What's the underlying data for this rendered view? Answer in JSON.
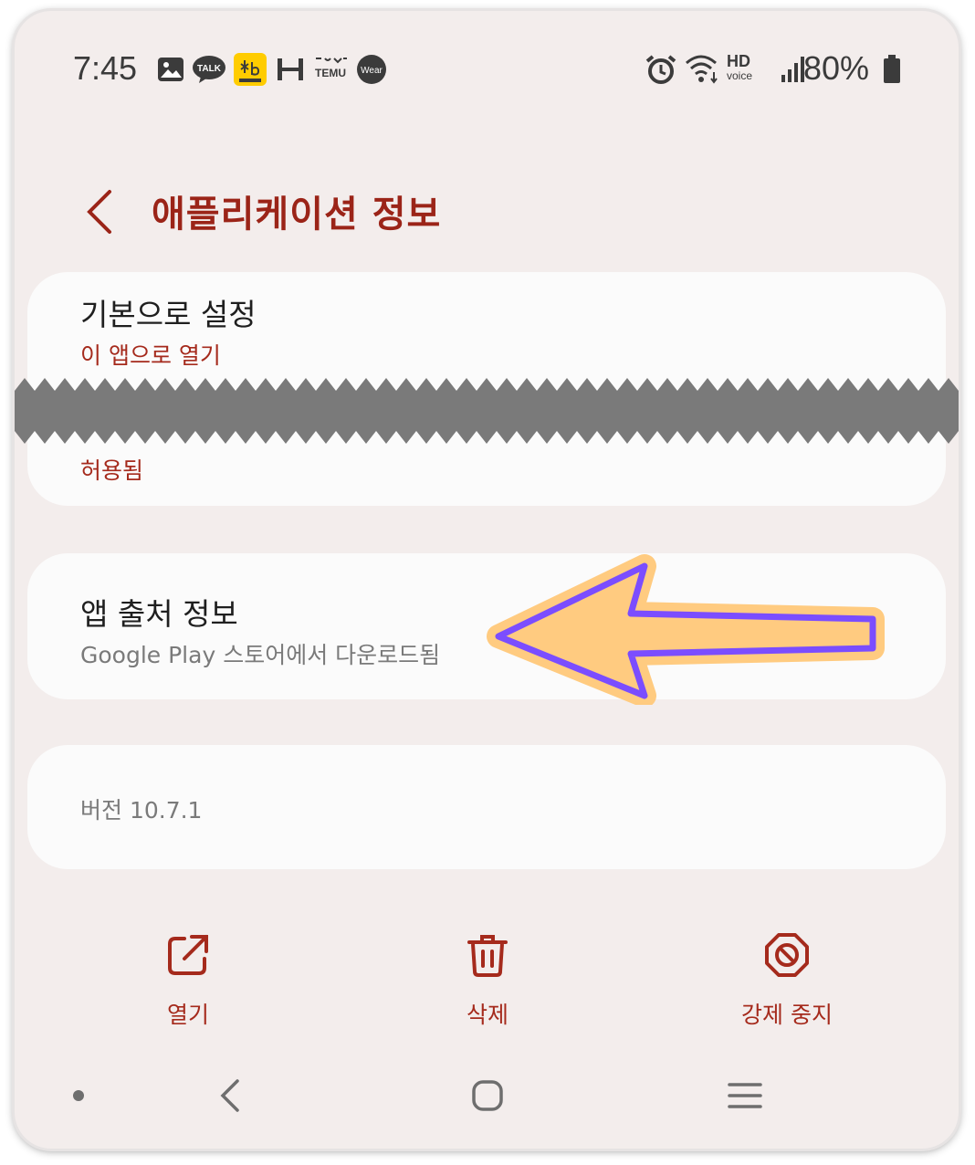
{
  "status_bar": {
    "time": "7:45",
    "notification_icons": [
      "gallery-icon",
      "kakaotalk-icon",
      "kb-bank-icon",
      "h-app-icon",
      "temu-icon",
      "wear-icon"
    ],
    "talk_label": "TALK",
    "temu_label": "TEMU",
    "wear_label": "Wear",
    "system_icons": [
      "alarm-icon",
      "wifi-icon",
      "signal-icon",
      "battery-icon"
    ],
    "hd_big": "HD",
    "hd_small": "voice",
    "battery": "80%"
  },
  "header": {
    "title": "애플리케이션 정보"
  },
  "defaults_card": {
    "title": "기본으로 설정",
    "subtitle": "이 앱으로 열기",
    "bottom_text": "허용됨"
  },
  "source_card": {
    "title": "앱 출처 정보",
    "subtitle": "Google Play 스토어에서 다운로드됨"
  },
  "version_card": {
    "text": "버전 10.7.1"
  },
  "actions": [
    {
      "label": "열기",
      "icon": "open-external-icon"
    },
    {
      "label": "삭제",
      "icon": "trash-icon"
    },
    {
      "label": "강제 중지",
      "icon": "stop-icon"
    }
  ],
  "nav": [
    "dot-icon",
    "back-icon",
    "home-icon",
    "recents-icon"
  ],
  "colors": {
    "accent": "#a52a1c",
    "background": "#f3edec",
    "card": "#fbfbfb",
    "arrow_fill": "#ffcb80",
    "arrow_stroke": "#7b4dff"
  }
}
